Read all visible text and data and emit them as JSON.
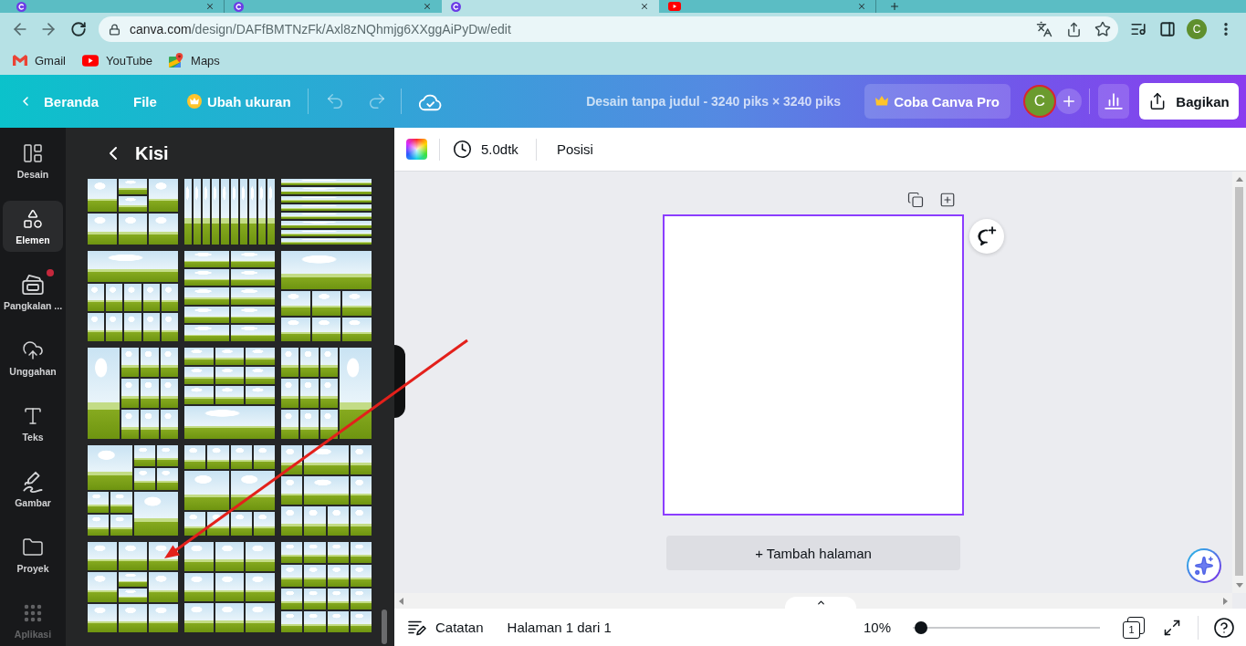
{
  "browser": {
    "tabs": [
      {
        "kind": "canva",
        "selected": false
      },
      {
        "kind": "canva",
        "selected": false
      },
      {
        "kind": "canva",
        "selected": true
      },
      {
        "kind": "youtube",
        "selected": false
      }
    ],
    "url_host": "canva.com",
    "url_path": "/design/DAFfBMTNzFk/Axl8zNQhmjg6XXggAiPyDw/edit",
    "profile_initial": "C",
    "bookmarks": [
      {
        "kind": "gmail",
        "label": "Gmail"
      },
      {
        "kind": "youtube",
        "label": "YouTube"
      },
      {
        "kind": "maps",
        "label": "Maps"
      }
    ]
  },
  "header": {
    "back_label": "Beranda",
    "file_label": "File",
    "resize_label": "Ubah ukuran",
    "undo": {
      "disabled": true
    },
    "redo": {
      "disabled": true
    },
    "title": "Desain tanpa judul - 3240 piks × 3240 piks",
    "pro_label": "Coba Canva Pro",
    "avatar_initial": "C",
    "share_label": "Bagikan"
  },
  "sidebar": {
    "items": [
      {
        "kind": "design",
        "label": "Desain",
        "selected": false,
        "badge": false,
        "dimmed": false
      },
      {
        "kind": "elements",
        "label": "Elemen",
        "selected": true,
        "badge": false,
        "dimmed": false
      },
      {
        "kind": "brand",
        "label": "Pangkalan ...",
        "selected": false,
        "badge": true,
        "dimmed": false
      },
      {
        "kind": "uploads",
        "label": "Unggahan",
        "selected": false,
        "badge": false,
        "dimmed": false
      },
      {
        "kind": "text",
        "label": "Teks",
        "selected": false,
        "badge": false,
        "dimmed": false
      },
      {
        "kind": "draw",
        "label": "Gambar",
        "selected": false,
        "badge": false,
        "dimmed": false
      },
      {
        "kind": "projects",
        "label": "Proyek",
        "selected": false,
        "badge": false,
        "dimmed": false
      },
      {
        "kind": "apps",
        "label": "Aplikasi",
        "selected": false,
        "badge": false,
        "dimmed": true
      }
    ]
  },
  "panel": {
    "title": "Kisi",
    "templates": [
      {
        "kind": "mosaic"
      },
      {
        "kind": "columns"
      },
      {
        "kind": "rows"
      },
      {
        "kind": "topfive"
      },
      {
        "kind": "pairs"
      },
      {
        "kind": "topthree"
      },
      {
        "kind": "leftpanel"
      },
      {
        "kind": "bottompanel"
      },
      {
        "kind": "rightpanel"
      },
      {
        "kind": "checker"
      },
      {
        "kind": "middlepair"
      },
      {
        "kind": "widecenter"
      },
      {
        "kind": "splitcenter"
      },
      {
        "kind": "nine"
      },
      {
        "kind": "sixteen"
      }
    ]
  },
  "toolbar": {
    "duration": "5.0dtk",
    "position_label": "Posisi"
  },
  "canvas": {
    "page": {
      "selected": true
    },
    "add_page_label": "+ Tambah halaman"
  },
  "footer": {
    "notes_label": "Catatan",
    "page_info": "Halaman 1 dari 1",
    "zoom": "10%",
    "zoom_slider": {
      "level": 0.01
    },
    "page_count": "1"
  },
  "annotations": [
    {
      "kind": "arrow"
    }
  ]
}
